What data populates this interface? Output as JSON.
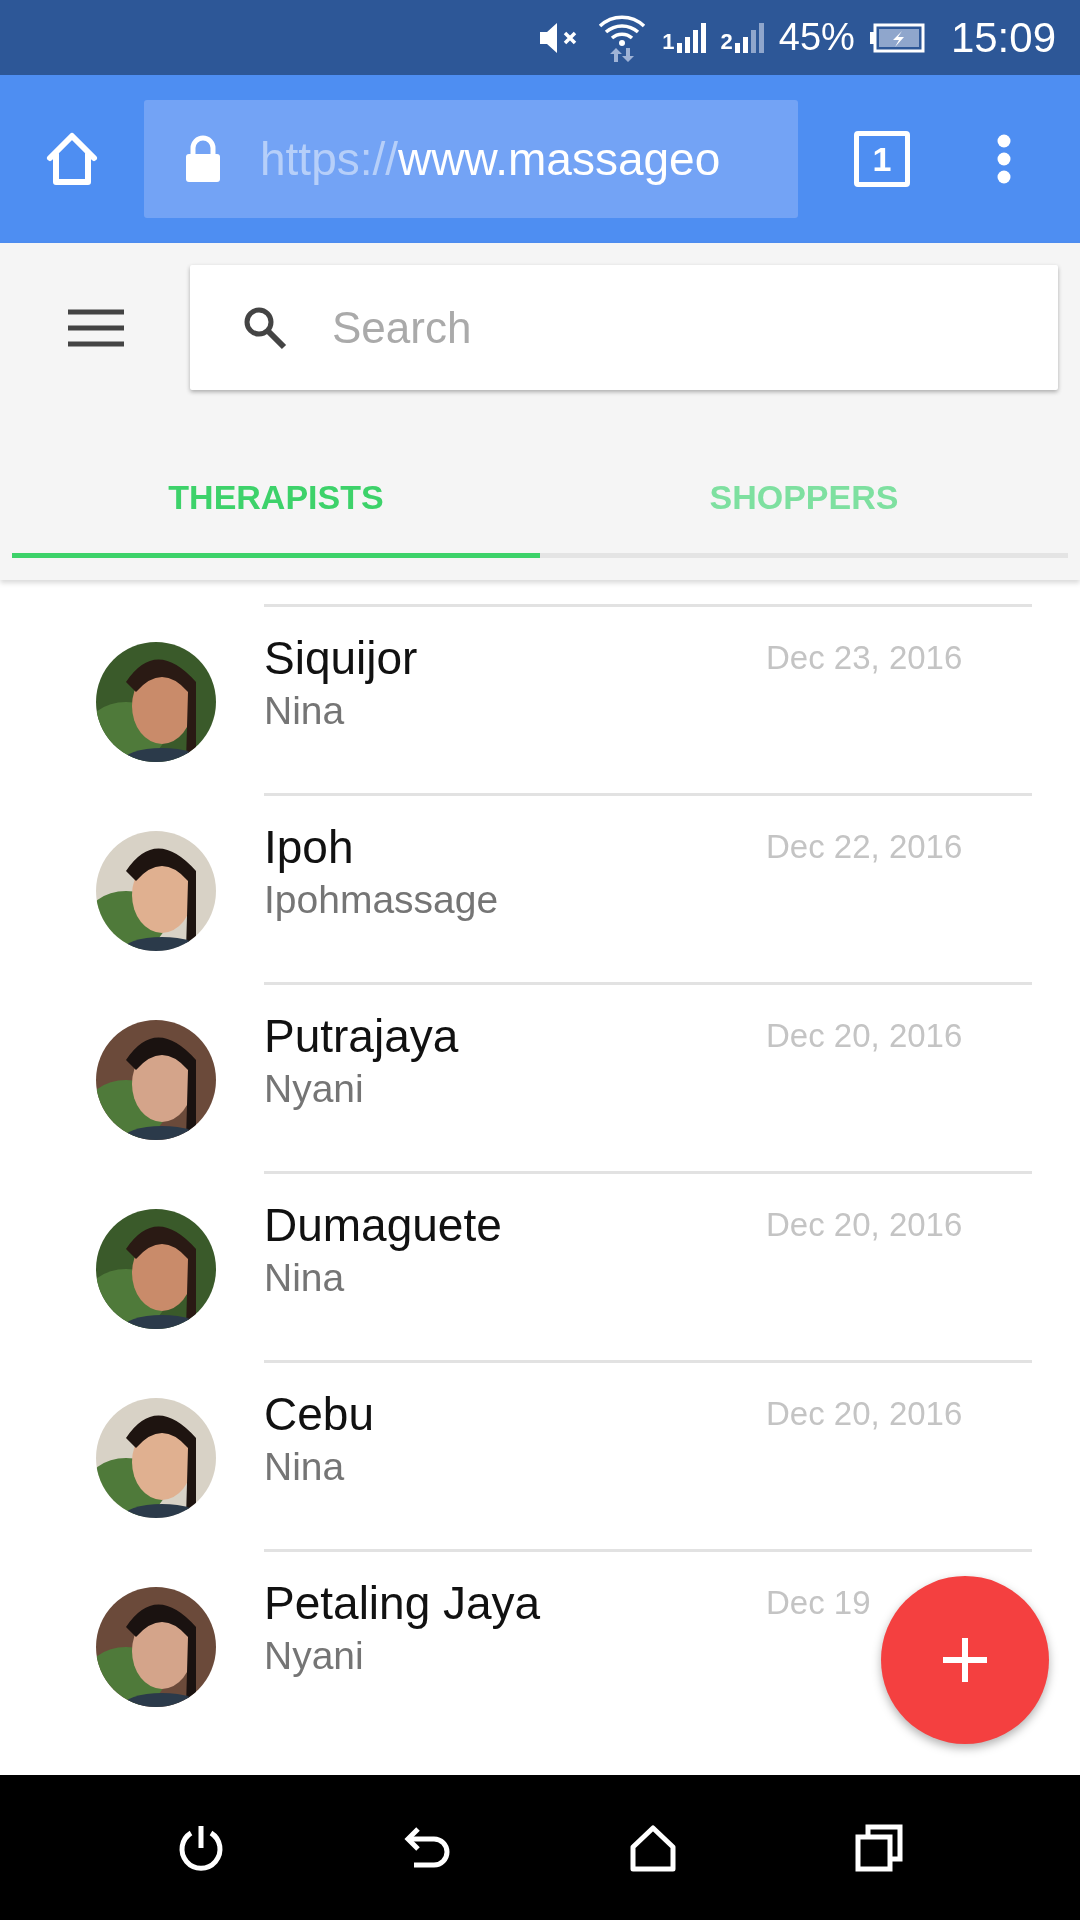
{
  "status_bar": {
    "sims": [
      "1",
      "2"
    ],
    "battery": "45%",
    "time": "15:09"
  },
  "browser": {
    "url_scheme": "https://",
    "url_host": "www.massageo",
    "tab_count": "1"
  },
  "search": {
    "placeholder": "Search"
  },
  "tabs": [
    {
      "label": "THERAPISTS",
      "selected": true
    },
    {
      "label": "SHOPPERS",
      "selected": false
    }
  ],
  "items": [
    {
      "title": "Siquijor",
      "subtitle": "Nina",
      "date": "Dec 23, 2016"
    },
    {
      "title": "Ipoh",
      "subtitle": "Ipohmassage",
      "date": "Dec 22, 2016"
    },
    {
      "title": "Putrajaya",
      "subtitle": "Nyani",
      "date": "Dec 20, 2016"
    },
    {
      "title": "Dumaguete",
      "subtitle": "Nina",
      "date": "Dec 20, 2016"
    },
    {
      "title": "Cebu",
      "subtitle": "Nina",
      "date": "Dec 20, 2016"
    },
    {
      "title": "Petaling Jaya",
      "subtitle": "Nyani",
      "date": "Dec 19"
    }
  ]
}
